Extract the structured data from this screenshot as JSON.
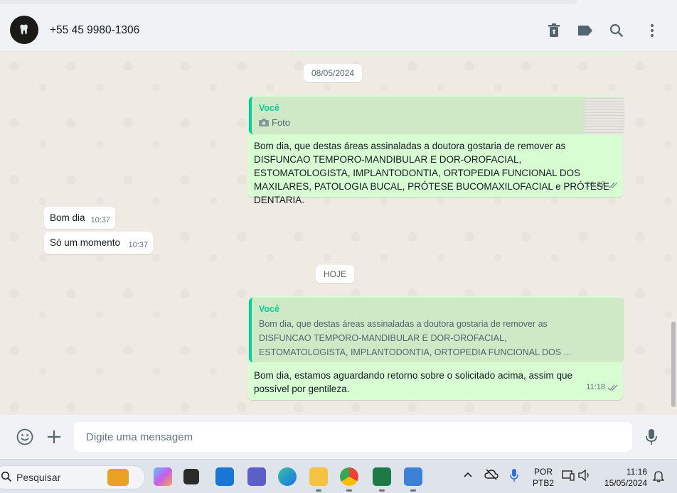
{
  "header": {
    "contact_name": "+55 45 9980-1306"
  },
  "chat": {
    "date_1": "08/05/2024",
    "date_2": "HOJE",
    "msg1": {
      "quote_author": "Você",
      "quote_label": "Foto",
      "text": "Bom dia, que destas áreas assinaladas a doutora gostaria de remover as DISFUNCAO TEMPORO-MANDIBULAR E DOR-OROFACIAL, ESTOMATOLOGISTA, IMPLANTODONTIA, ORTOPEDIA FUNCIONAL DOS MAXILARES, PATOLOGIA BUCAL, PRÓTESE BUCOMAXILOFACIAL e PRÓTESE DENTARIA.",
      "time": "10:37"
    },
    "msg2": {
      "text": "Bom dia",
      "time": "10:37"
    },
    "msg3": {
      "text": "Só um momento",
      "time": "10:37"
    },
    "msg4": {
      "quote_author": "Você",
      "quote_text": "Bom dia, que destas áreas assinaladas a doutora gostaria de remover as DISFUNCAO TEMPORO-MANDIBULAR E DOR-OROFACIAL, ESTOMATOLOGISTA, IMPLANTODONTIA, ORTOPEDIA FUNCIONAL DOS ...",
      "text": "Bom dia, estamos aguardando retorno sobre o solicitado acima, assim que possível por gentileza.",
      "time": "11:18"
    }
  },
  "composer": {
    "placeholder": "Digite uma mensagem"
  },
  "taskbar": {
    "search_label": "Pesquisar",
    "lang_1": "POR",
    "lang_2": "PTB2",
    "time": "11:16",
    "date": "15/05/2024"
  },
  "colors": {
    "outgoing_bubble": "#d9fdd3",
    "incoming_bubble": "#ffffff",
    "accent": "#06cf9c",
    "chat_bg": "#efeae2"
  }
}
